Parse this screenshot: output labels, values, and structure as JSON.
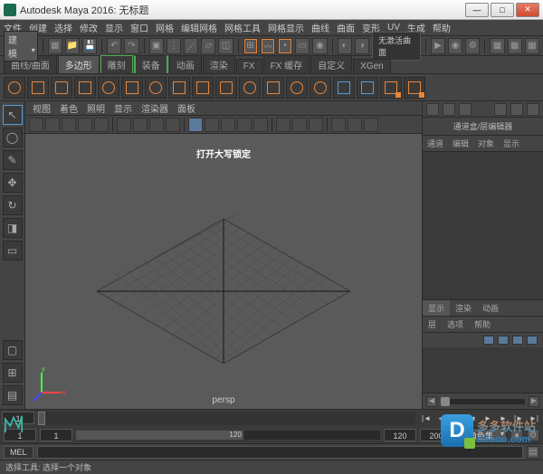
{
  "window": {
    "title": "Autodesk Maya 2016: 无标题"
  },
  "menubar": [
    "文件",
    "创建",
    "选择",
    "修改",
    "显示",
    "窗口",
    "网格",
    "编辑网格",
    "网格工具",
    "网格显示",
    "曲线",
    "曲面",
    "变形",
    "UV",
    "生成",
    "帮助"
  ],
  "workspace_dropdown": "建模",
  "status_field": "无激活曲面",
  "shelf_tabs": [
    {
      "label": "曲线/曲面"
    },
    {
      "label": "多边形",
      "active": true
    },
    {
      "label": "雕刻",
      "green": true
    },
    {
      "label": "装备",
      "green": true
    },
    {
      "label": "动画"
    },
    {
      "label": "渲染"
    },
    {
      "label": "FX"
    },
    {
      "label": "FX 缓存"
    },
    {
      "label": "自定义"
    },
    {
      "label": "XGen"
    }
  ],
  "panel_menu": [
    "视图",
    "着色",
    "照明",
    "显示",
    "渲染器",
    "面板"
  ],
  "viewport": {
    "hud": "打开大写锁定",
    "camera": "persp"
  },
  "channelbox": {
    "title": "通道盒/层编辑器",
    "tabs": [
      "通道",
      "编辑",
      "对象",
      "显示"
    ],
    "layer_tabs": [
      "显示",
      "渲染",
      "动画"
    ],
    "layer_menu": [
      "层",
      "选项",
      "帮助"
    ]
  },
  "timeline": {
    "current": "1",
    "range_start": "1",
    "playback_start": "1",
    "playback_end": "120",
    "range_end": "200",
    "extra1": "120",
    "extra2": "200",
    "anim_dropdown": "无角色集"
  },
  "cmdline": {
    "lang": "MEL"
  },
  "helpline": "选择工具: 选择一个对象",
  "watermark": {
    "cn": "多多软件站",
    "url": "ddooo.com"
  }
}
